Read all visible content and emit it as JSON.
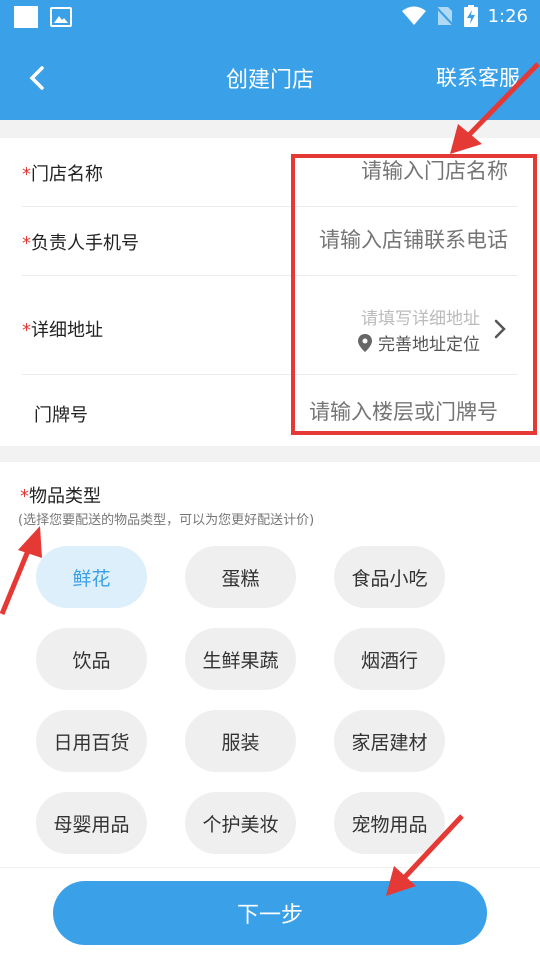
{
  "status_bar": {
    "time": "1:26"
  },
  "app_bar": {
    "title": "创建门店",
    "contact_label": "联系客服"
  },
  "form": {
    "required_mark": "*",
    "store_name": {
      "label": "门店名称",
      "placeholder": "请输入门店名称"
    },
    "phone": {
      "label": "负责人手机号",
      "placeholder": "请输入店铺联系电话"
    },
    "address": {
      "label": "详细地址",
      "hint": "请填写详细地址",
      "locate_label": "完善地址定位"
    },
    "door_no": {
      "label": "门牌号",
      "placeholder": "请输入楼层或门牌号"
    }
  },
  "item_types": {
    "title": "物品类型",
    "subtitle": "(选择您要配送的物品类型，可以为您更好配送计价)",
    "options": [
      "鲜花",
      "蛋糕",
      "食品小吃",
      "饮品",
      "生鲜果蔬",
      "烟酒行",
      "日用百货",
      "服装",
      "家居建材",
      "母婴用品",
      "个护美妆",
      "宠物用品"
    ],
    "selected": "鲜花"
  },
  "next_button": "下一步",
  "colors": {
    "primary": "#3aa0e8",
    "selected_chip_bg": "#dceffb",
    "annotation_red": "#e53935"
  }
}
